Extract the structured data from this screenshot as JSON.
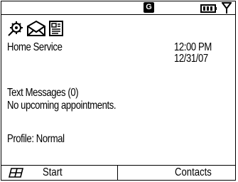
{
  "status_bar": {
    "network_badge": "G",
    "icons": [
      "battery-icon",
      "signal-icon"
    ]
  },
  "app_icons": [
    "settings-icon",
    "message-envelope-icon",
    "calendar-icon"
  ],
  "home": {
    "carrier": "Home Service",
    "time": "12:00 PM",
    "date": "12/31/07",
    "text_messages": "Text Messages (0)",
    "appointments": "No upcoming appointments.",
    "profile": "Profile: Normal"
  },
  "softkeys": {
    "start_label": "Start",
    "contacts_label": "Contacts"
  }
}
